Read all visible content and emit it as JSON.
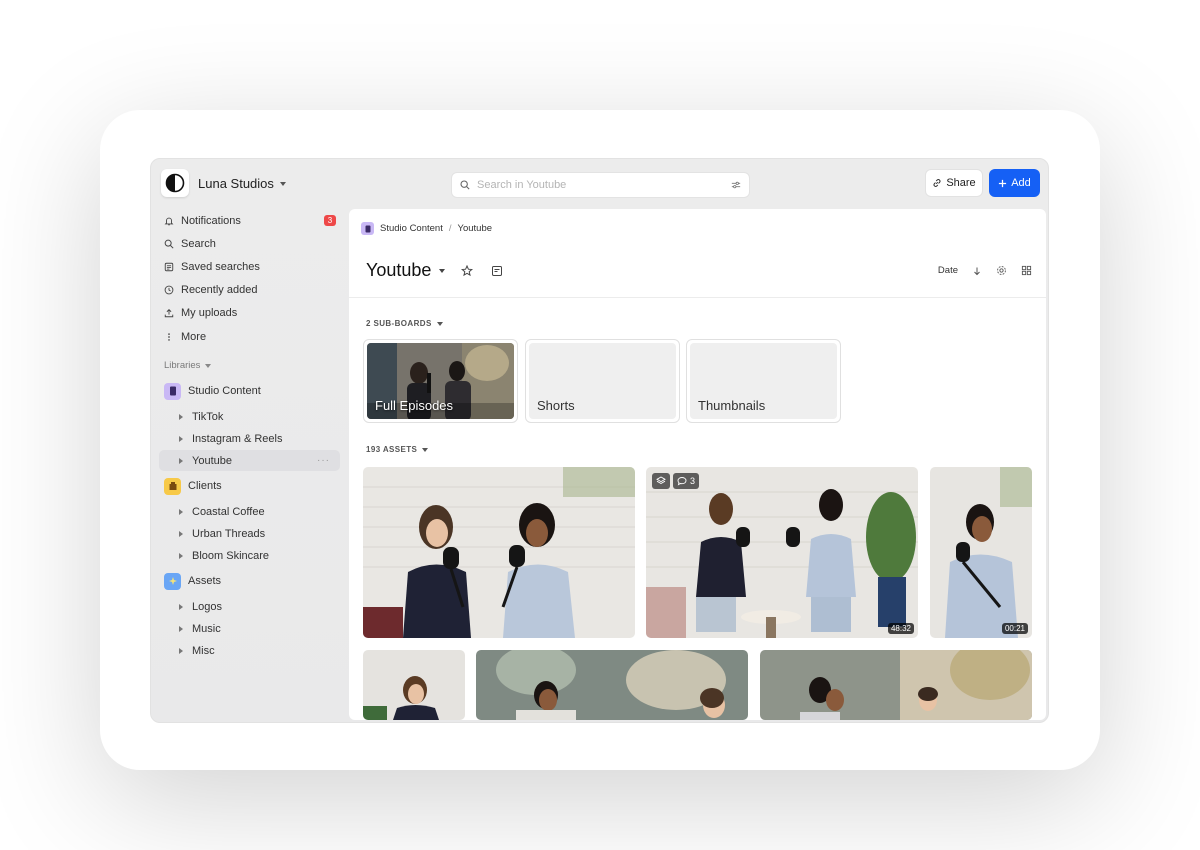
{
  "app": {
    "workspace": "Luna Studios"
  },
  "search": {
    "placeholder": "Search in Youtube"
  },
  "actions": {
    "share": "Share",
    "add": "Add"
  },
  "nav": [
    {
      "label": "Notifications",
      "icon": "bell-icon",
      "badge": "3"
    },
    {
      "label": "Search",
      "icon": "search-icon"
    },
    {
      "label": "Saved searches",
      "icon": "saved-search-icon"
    },
    {
      "label": "Recently added",
      "icon": "clock-icon"
    },
    {
      "label": "My uploads",
      "icon": "upload-icon"
    },
    {
      "label": "More",
      "icon": "more-vertical-icon"
    }
  ],
  "libraries": {
    "label": "Libraries",
    "groups": [
      {
        "label": "Studio Content",
        "icon": "phone-icon",
        "color": "#c9b8f5",
        "children": [
          "TikTok",
          "Instagram & Reels",
          "Youtube"
        ]
      },
      {
        "label": "Clients",
        "icon": "building-icon",
        "color": "#f7c948",
        "children": [
          "Coastal Coffee",
          "Urban Threads",
          "Bloom Skincare"
        ]
      },
      {
        "label": "Assets",
        "icon": "sparkle-icon",
        "color": "#6aa6f5",
        "children": [
          "Logos",
          "Music",
          "Misc"
        ]
      }
    ],
    "active": "Youtube",
    "active_more": "···"
  },
  "breadcrumb": {
    "parent": "Studio Content",
    "separator": "/",
    "current": "Youtube"
  },
  "board": {
    "title": "Youtube",
    "sort_label": "Date"
  },
  "subboards": {
    "count_label": "2 SUB-BOARDS",
    "items": [
      "Full Episodes",
      "Shorts",
      "Thumbnails"
    ]
  },
  "assets": {
    "count_label": "193 ASSETS",
    "comment_count": "3",
    "durations": [
      "48:32",
      "00:21"
    ]
  },
  "colors": {
    "accent": "#1560f5",
    "badge": "#ee4848"
  }
}
